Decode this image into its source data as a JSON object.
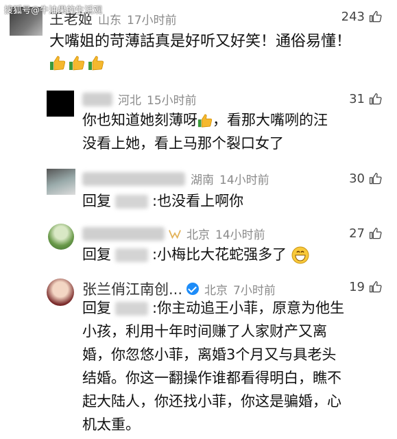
{
  "watermark": "搜狐号@牛油果的生活观",
  "comments": [
    {
      "name": "王老姬",
      "location": "山东",
      "time": "17小时前",
      "likes": "243",
      "text": "大嘴姐的苛薄話真是好听又好笑！通俗易懂！"
    },
    {
      "location": "河北",
      "time": "15小时前",
      "likes": "31",
      "line1": "你也知道她刻薄呀",
      "line1b": "，看那大嘴咧的汪",
      "line2": "没看上她，看上马那个裂口女了"
    },
    {
      "location": "湖南",
      "time": "14小时前",
      "likes": "30",
      "reply_label": "回复",
      "text": ":也没看上啊你"
    },
    {
      "location": "北京",
      "time": "14小时前",
      "likes": "27",
      "reply_label": "回复",
      "text": ":小梅比大花蛇强多了"
    },
    {
      "name": "张兰俏江南创...",
      "location": "北京",
      "time": "7小时前",
      "likes": "19",
      "reply_label": "回复",
      "line1": ":你主动追王小菲，原意为他生",
      "lines": [
        "小孩，利用十年时间赚了人家财产又离",
        "婚，你忽悠小菲，离婚3个月又与具老头",
        "结婚。你这一翻操作谁都看得明白，瞧不",
        "起大陆人，你还找小菲，你这是骗婚，心",
        "机太重。"
      ]
    }
  ]
}
